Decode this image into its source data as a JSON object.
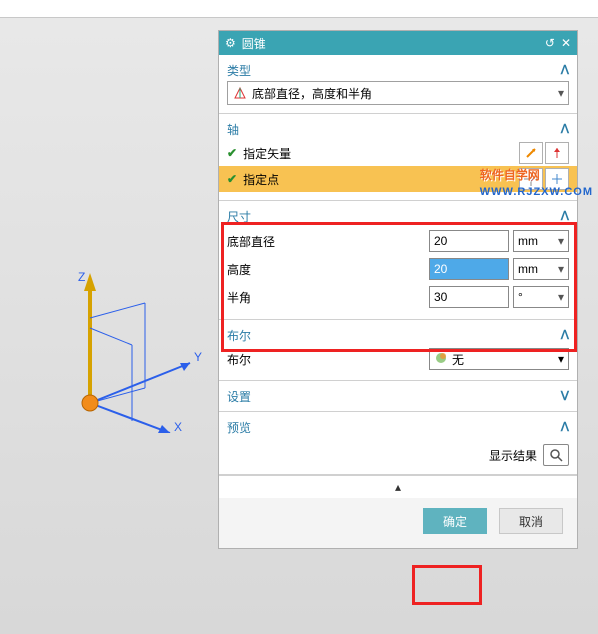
{
  "dialog": {
    "title": "圆锥",
    "type": {
      "section": "类型",
      "option": "底部直径，高度和半角"
    },
    "axis": {
      "section": "轴",
      "vector_label": "指定矢量",
      "point_label": "指定点"
    },
    "dim": {
      "section": "尺寸",
      "rows": [
        {
          "label": "底部直径",
          "value": "20",
          "unit": "mm"
        },
        {
          "label": "高度",
          "value": "20",
          "unit": "mm"
        },
        {
          "label": "半角",
          "value": "30",
          "unit": "°"
        }
      ]
    },
    "bool": {
      "section": "布尔",
      "label": "布尔",
      "value": "无"
    },
    "settings": {
      "section": "设置"
    },
    "preview": {
      "section": "预览",
      "show": "显示结果"
    },
    "buttons": {
      "ok": "确定",
      "cancel": "取消"
    }
  },
  "axes": {
    "x": "X",
    "y": "Y",
    "z": "Z"
  },
  "watermark": {
    "main": "软件自学网",
    "sub": "WWW.RJZXW.COM"
  }
}
